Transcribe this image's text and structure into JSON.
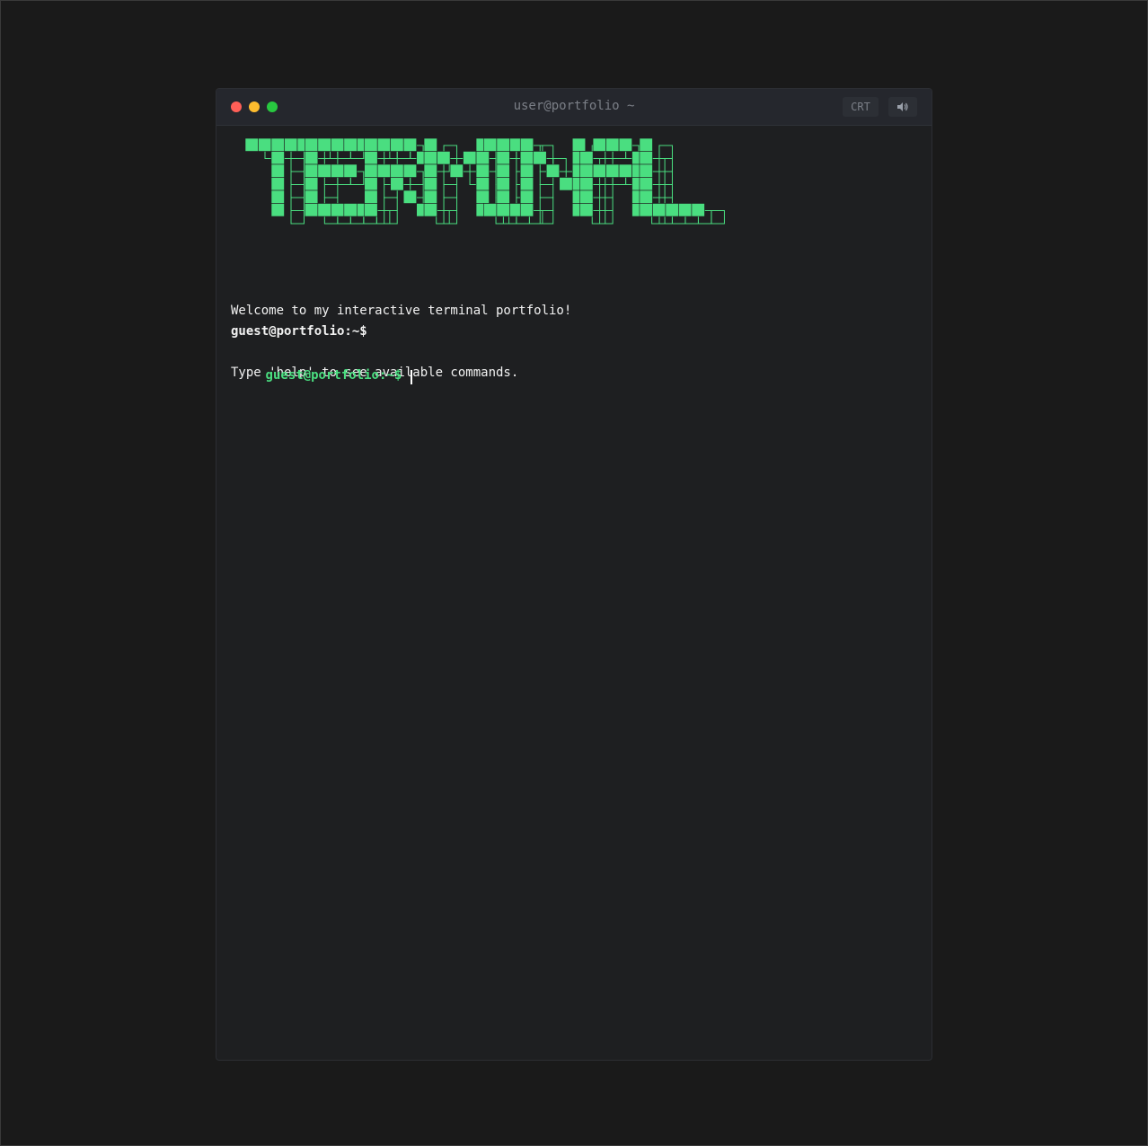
{
  "window": {
    "title": "user@portfolio ~",
    "crt_label": "CRT",
    "sound_icon": "speaker-icon"
  },
  "colors": {
    "accent_green": "#4ade80",
    "dot_close": "#ff5f57",
    "dot_minimize": "#febc2e",
    "dot_maximize": "#28c840",
    "background": "#1e1f21"
  },
  "banner": {
    "text": "TERMINAL"
  },
  "output": {
    "lines": [
      "Welcome to my interactive terminal portfolio!",
      "Type 'help' to see available commands."
    ],
    "previous_prompt": "guest@portfolio:~$"
  },
  "input": {
    "prompt": "guest@portfolio:~$",
    "value": ""
  }
}
